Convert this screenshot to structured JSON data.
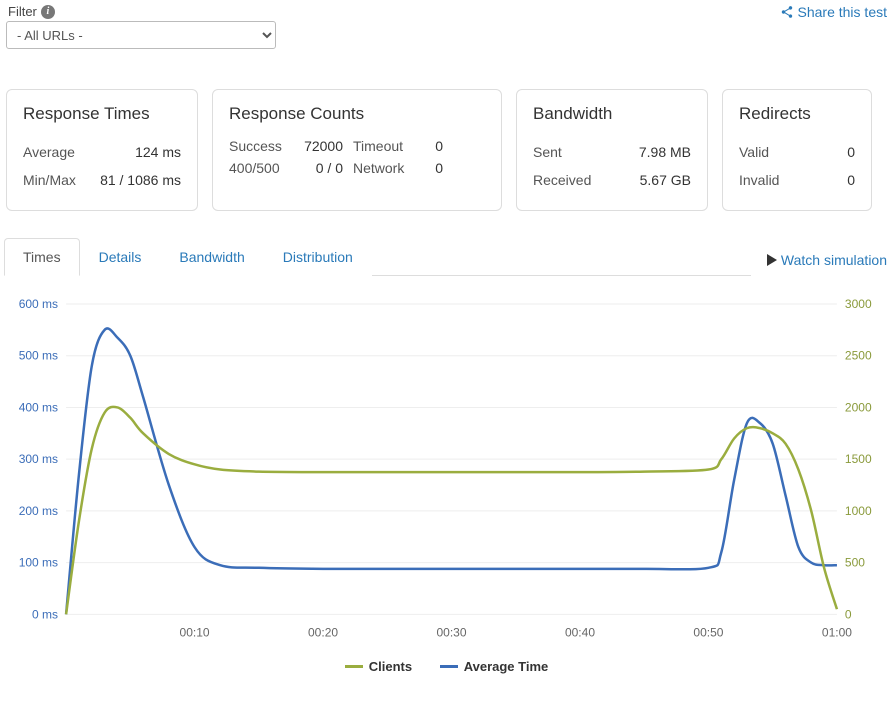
{
  "topbar": {
    "filter_label": "Filter",
    "filter_selected": "- All URLs -",
    "share_label": "Share this test"
  },
  "cards": {
    "response_times": {
      "title": "Response Times",
      "avg_label": "Average",
      "avg_value": "124 ms",
      "minmax_label": "Min/Max",
      "minmax_value": "81 / 1086 ms"
    },
    "response_counts": {
      "title": "Response Counts",
      "success_label": "Success",
      "success_value": "72000",
      "timeout_label": "Timeout",
      "timeout_value": "0",
      "err_label": "400/500",
      "err_value": "0 / 0",
      "network_label": "Network",
      "network_value": "0"
    },
    "bandwidth": {
      "title": "Bandwidth",
      "sent_label": "Sent",
      "sent_value": "7.98 MB",
      "recv_label": "Received",
      "recv_value": "5.67 GB"
    },
    "redirects": {
      "title": "Redirects",
      "valid_label": "Valid",
      "valid_value": "0",
      "invalid_label": "Invalid",
      "invalid_value": "0"
    }
  },
  "tabs": {
    "items": [
      "Times",
      "Details",
      "Bandwidth",
      "Distribution"
    ],
    "active_index": 0,
    "watch_label": "Watch simulation"
  },
  "legend": {
    "clients": "Clients",
    "avg": "Average Time"
  },
  "chart_data": {
    "type": "line",
    "title": "",
    "xlabel": "",
    "x_ticks": [
      "00:10",
      "00:20",
      "00:30",
      "00:40",
      "00:50",
      "01:00"
    ],
    "y1": {
      "label": "ms",
      "min": 0,
      "max": 600,
      "ticks": [
        0,
        100,
        200,
        300,
        400,
        500,
        600
      ]
    },
    "y2": {
      "label": "",
      "min": 0,
      "max": 3000,
      "ticks": [
        0,
        500,
        1000,
        1500,
        2000,
        2500,
        3000
      ]
    },
    "series": [
      {
        "name": "Average Time",
        "axis": "y1",
        "x_seconds": [
          0,
          1,
          2,
          3,
          4,
          5,
          6,
          8,
          10,
          12,
          15,
          20,
          25,
          30,
          35,
          40,
          45,
          50,
          51,
          52,
          53,
          54,
          55,
          56,
          57,
          58,
          59,
          60
        ],
        "values": [
          0,
          270,
          480,
          550,
          535,
          500,
          420,
          250,
          130,
          95,
          90,
          88,
          88,
          88,
          88,
          88,
          88,
          90,
          120,
          260,
          370,
          370,
          330,
          230,
          130,
          100,
          95,
          95
        ]
      },
      {
        "name": "Clients",
        "axis": "y2",
        "x_seconds": [
          0,
          1,
          2,
          3,
          4,
          5,
          6,
          8,
          10,
          12,
          15,
          20,
          25,
          30,
          35,
          40,
          45,
          50,
          51,
          52,
          53,
          54,
          55,
          56,
          57,
          58,
          59,
          60
        ],
        "values": [
          0,
          900,
          1600,
          1950,
          2000,
          1900,
          1750,
          1550,
          1450,
          1400,
          1380,
          1375,
          1375,
          1375,
          1375,
          1375,
          1380,
          1400,
          1500,
          1700,
          1800,
          1800,
          1750,
          1650,
          1400,
          1000,
          450,
          50
        ]
      }
    ]
  }
}
